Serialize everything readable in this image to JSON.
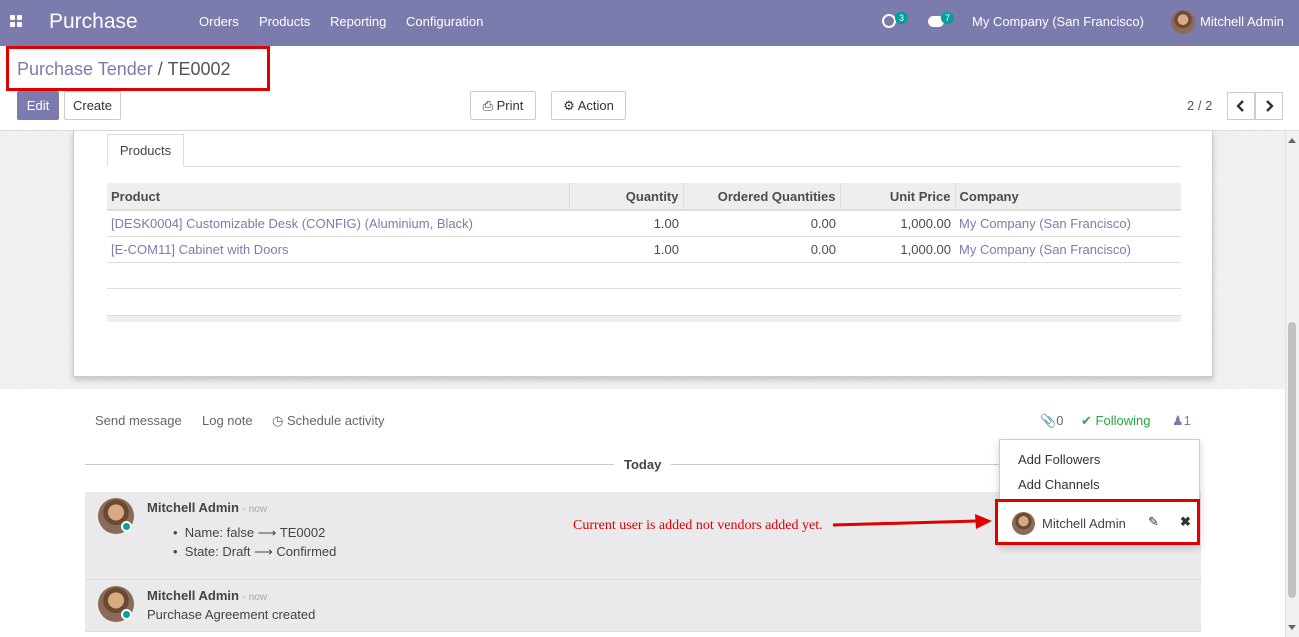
{
  "topbar": {
    "app_name": "Purchase",
    "menu": [
      "Orders",
      "Products",
      "Reporting",
      "Configuration"
    ],
    "activity_count": "3",
    "messages_count": "7",
    "company": "My Company (San Francisco)",
    "user": "Mitchell Admin",
    "bg_color": "#7c7bad"
  },
  "breadcrumb": {
    "parent": "Purchase Tender",
    "separator": "/",
    "current": "TE0002"
  },
  "buttons": {
    "edit": "Edit",
    "create": "Create",
    "print": "Print",
    "action": "Action"
  },
  "pager": {
    "value": "2 / 2"
  },
  "tabs": {
    "products": "Products"
  },
  "table": {
    "headers": [
      "Product",
      "Quantity",
      "Ordered Quantities",
      "Unit Price",
      "Company"
    ],
    "rows": [
      [
        "[DESK0004] Customizable Desk (CONFIG) (Aluminium, Black)",
        "1.00",
        "0.00",
        "1,000.00",
        "My Company (San Francisco)"
      ],
      [
        "[E-COM11] Cabinet with Doors",
        "1.00",
        "0.00",
        "1,000.00",
        "My Company (San Francisco)"
      ]
    ]
  },
  "chatter": {
    "send_message": "Send message",
    "log_note": "Log note",
    "schedule_activity": "Schedule activity",
    "attachments": "0",
    "following": "Following",
    "followers_count": "1",
    "today": "Today",
    "messages": [
      {
        "author": "Mitchell Admin",
        "time": "- now",
        "changes": [
          "Name: false",
          "TE0002",
          "State: Draft",
          "Confirmed"
        ]
      },
      {
        "author": "Mitchell Admin",
        "time": "- now",
        "body": "Purchase Agreement created"
      }
    ]
  },
  "followers_dropdown": {
    "add_followers": "Add Followers",
    "add_channels": "Add Channels",
    "follower": "Mitchell Admin"
  },
  "annotation": "Current user is added not vendors added yet."
}
